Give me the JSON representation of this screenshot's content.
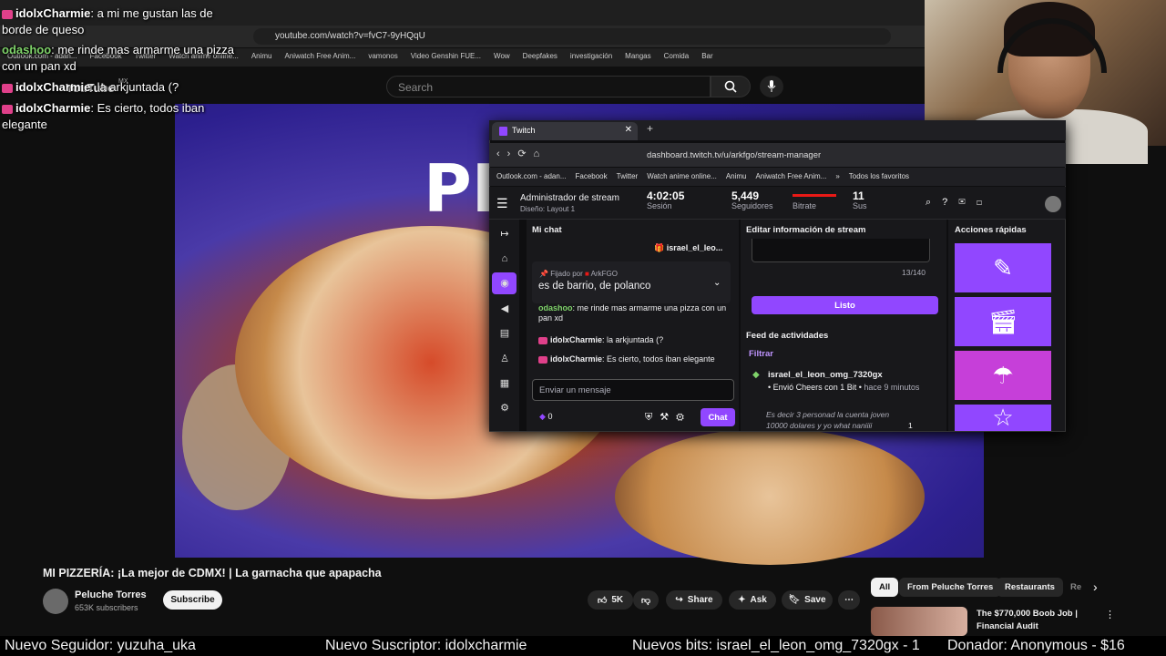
{
  "browser": {
    "url": "youtube.com/watch?v=fvC7-9yHQqU",
    "bookmarks": [
      "Outlook.com - adan...",
      "Facebook",
      "Twitter",
      "Watch anime online...",
      "Animu",
      "Aniwatch Free Anim...",
      "vamonos",
      "Video Genshin FUE...",
      "Wow",
      "Deepfakes",
      "investigación",
      "Mangas",
      "Comida",
      "Bar"
    ]
  },
  "youtube": {
    "search_placeholder": "Search",
    "logo_text": "YouTube",
    "region": "MX",
    "video_title": "MI PIZZERÍA: ¡La mejor de CDMX! | La garnacha que apapacha",
    "channel_name": "Peluche Torres",
    "subscribers": "653K subscribers",
    "subscribe_label": "Subscribe",
    "likes": "5K",
    "share_label": "Share",
    "ask_label": "Ask",
    "save_label": "Save",
    "more_label": "⋯",
    "chips": [
      "All",
      "From Peluche Torres",
      "Restaurants",
      "Re"
    ],
    "rec_title": "The $770,000 Boob Job |",
    "rec_sub": "Financial Audit",
    "video_overlay_text": "PI"
  },
  "overlay_chat": [
    {
      "user": "idolxCharmie",
      "msg": "a mi me gustan las de",
      "cont": "borde de queso"
    },
    {
      "user": "odashoo",
      "msg": "me rinde mas armarme una pizza",
      "cont": "con un pan xd"
    },
    {
      "user": "idolxCharmie",
      "msg": "la arkjuntada (?",
      "cont": ""
    },
    {
      "user": "idolxCharmie",
      "msg": "Es cierto, todos iban",
      "cont": "elegante"
    }
  ],
  "twitch": {
    "tab_title": "Twitch",
    "url": "dashboard.twitch.tv/u/arkfgo/stream-manager",
    "bookmarks": [
      "Outlook.com - adan...",
      "Facebook",
      "Twitter",
      "Watch anime online...",
      "Animu",
      "Aniwatch Free Anim...",
      "»",
      "Todos los favoritos"
    ],
    "header_title": "Administrador de stream",
    "header_sub": "Diseño: Layout 1",
    "session_time": "4:02:05",
    "session_label": "Sesión",
    "followers": "5,449",
    "followers_label": "Seguidores",
    "bitrate_label": "Bitrate",
    "subs": "11",
    "subs_label": "Sus",
    "chat_title": "Mi chat",
    "gift_user": "israel_el_leo...",
    "pinned_by": "Fijado por",
    "pinned_author": "ArkFGO",
    "pinned_msg": "es de barrio, de polanco",
    "chat_messages": [
      {
        "user": "odashoo",
        "msg": "me rinde mas armarme una pizza con un pan xd"
      },
      {
        "user": "idolxCharmie",
        "msg": "la arkjuntada (?"
      },
      {
        "user": "idolxCharmie",
        "msg": "Es cierto, todos iban elegante"
      }
    ],
    "chat_placeholder": "Enviar un mensaje",
    "bits": "0",
    "chat_button": "Chat",
    "info_title": "Editar información de stream",
    "char_count": "13/140",
    "done_label": "Listo",
    "feed_title": "Feed de actividades",
    "filter_label": "Filtrar",
    "feed_user": "israel_el_leon_omg_7320gx",
    "feed_action": "Envió Cheers con 1 Bit",
    "feed_time": "hace 9 minutos",
    "feed_msg": "Es decir 3 personad la cuenta joven 10000 dolares y yo what naniiii",
    "feed_count": "1",
    "quick_title": "Acciones rápidas"
  },
  "ticker": {
    "follower": "Nuevo Seguidor: yuzuha_uka",
    "subscriber": "Nuevo Suscriptor: idolxcharmie",
    "bits": "Nuevos bits: israel_el_leon_omg_7320gx - 1",
    "donor": "Donador: Anonymous - $16"
  },
  "colors": {
    "twitch_purple": "#9147ff",
    "yt_bg": "#0f0f0f"
  }
}
